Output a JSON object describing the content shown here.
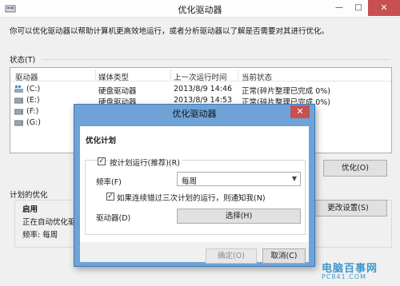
{
  "window": {
    "title": "优化驱动器",
    "controls": {
      "minimize": "—",
      "maximize": "□",
      "close": "✕"
    }
  },
  "description": "你可以优化驱动器以帮助计算机更高效地运行，或者分析驱动器以了解是否需要对其进行优化。",
  "status": {
    "label": "状态(T)",
    "columns": [
      "驱动器",
      "媒体类型",
      "上一次运行时间",
      "当前状态"
    ],
    "drives": [
      {
        "name": "(C:)",
        "media": "硬盘驱动器",
        "last_run": "2013/8/9 14:46",
        "state": "正常(碎片整理已完成 0%)",
        "icon": "windows-drive-icon"
      },
      {
        "name": "(E:)",
        "media": "硬盘驱动器",
        "last_run": "2013/8/9 14:53",
        "state": "正常(碎片整理已完成 0%)",
        "icon": "hard-drive-icon"
      },
      {
        "name": "(F:)",
        "media": "",
        "last_run": "",
        "state": "",
        "icon": "hard-drive-icon"
      },
      {
        "name": "(G:)",
        "media": "",
        "last_run": "",
        "state": "",
        "icon": "hard-drive-icon"
      }
    ]
  },
  "buttons": {
    "optimize": "优化(O)",
    "change_settings": "更改设置(S)"
  },
  "schedule": {
    "label": "计划的优化",
    "state": "启用",
    "auto_text": "正在自动优化驱动",
    "frequency": "频率: 每周"
  },
  "dialog": {
    "title": "优化驱动器",
    "close": "✕",
    "section_title": "优化计划",
    "run_on_schedule": {
      "label": "按计划运行(推荐)(R)",
      "checked": true
    },
    "frequency_label": "频率(F)",
    "frequency_value": "每周",
    "notify": {
      "label": "如果连续错过三次计划的运行，则通知我(N)",
      "checked": true
    },
    "drives_label": "驱动器(D)",
    "choose_button": "选择(H)",
    "ok_button": "确定(O)",
    "cancel_button": "取消(C)"
  },
  "watermark": {
    "text": "电脑百事网",
    "sub": "PC841.COM"
  },
  "colors": {
    "dialog_frame": "#6fa3d8",
    "close_button": "#c75050",
    "window_bg": "#f0f0f0",
    "watermark": "#1e88c8"
  }
}
